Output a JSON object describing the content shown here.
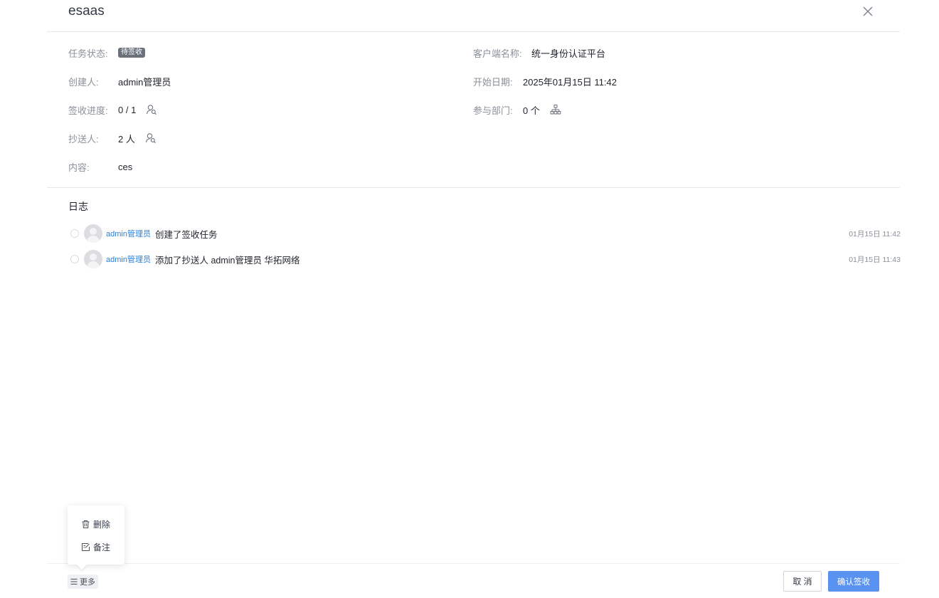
{
  "header": {
    "title": "esaas"
  },
  "info": {
    "status_label": "任务状态:",
    "status_value": "待签收",
    "client_label": "客户端名称:",
    "client_value": "统一身份认证平台",
    "creator_label": "创建人:",
    "creator_value": "admin管理员",
    "start_label": "开始日期:",
    "start_value": "2025年01月15日 11:42",
    "progress_label": "签收进度:",
    "progress_value": "0 / 1",
    "dept_label": "参与部门:",
    "dept_value": "0 个",
    "cc_label": "抄送人:",
    "cc_value": "2 人",
    "content_label": "内容:",
    "content_value": "ces"
  },
  "log": {
    "title": "日志",
    "items": [
      {
        "user": "admin管理员",
        "action": "创建了签收任务",
        "time": "01月15日 11:42"
      },
      {
        "user": "admin管理员",
        "action": "添加了抄送人 admin管理员 华拓网络",
        "time": "01月15日 11:43"
      }
    ]
  },
  "popup": {
    "delete_label": "删除",
    "note_label": "备注"
  },
  "footer": {
    "more_label": "更多",
    "cancel_label": "取 消",
    "confirm_label": "确认签收"
  },
  "colors": {
    "accent": "#5a92f2",
    "link": "#2a7fd9",
    "tag_bg": "#6b717a"
  }
}
